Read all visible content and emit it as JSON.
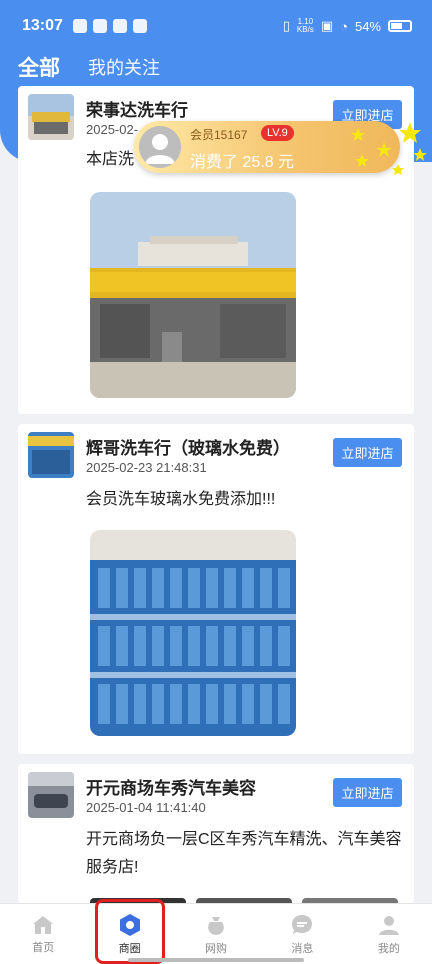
{
  "status_bar": {
    "time": "13:07",
    "net_speed_top": "1.10",
    "net_speed_bottom": "KB/s",
    "battery": "54%"
  },
  "tabs": [
    {
      "label": "全部",
      "active": true
    },
    {
      "label": "我的关注",
      "active": false
    }
  ],
  "posts": [
    {
      "shop": "荣事达洗车行",
      "time": "2025-02-",
      "desc": "本店洗",
      "button": "立即进店"
    },
    {
      "shop": "辉哥洗车行（玻璃水免费）",
      "time": "2025-02-23 21:48:31",
      "desc": "会员洗车玻璃水免费添加!!!",
      "button": "立即进店"
    },
    {
      "shop": "开元商场车秀汽车美容",
      "time": "2025-01-04 11:41:40",
      "desc": "开元商场负一层C区车秀汽车精洗、汽车美容服务店!",
      "button": "立即进店"
    }
  ],
  "toast": {
    "user": "会员15167",
    "level": "LV.9",
    "spent": "消费了 25.8 元"
  },
  "bottom_nav": [
    {
      "label": "首页",
      "icon": "home-icon",
      "active": false
    },
    {
      "label": "商圈",
      "icon": "hexagon-icon",
      "active": true
    },
    {
      "label": "网购",
      "icon": "bag-icon",
      "active": false
    },
    {
      "label": "消息",
      "icon": "chat-icon",
      "active": false
    },
    {
      "label": "我的",
      "icon": "user-icon",
      "active": false
    }
  ],
  "colors": {
    "accent": "#4a8ef0",
    "highlight": "#e02020",
    "toast": "#f4c46e"
  }
}
